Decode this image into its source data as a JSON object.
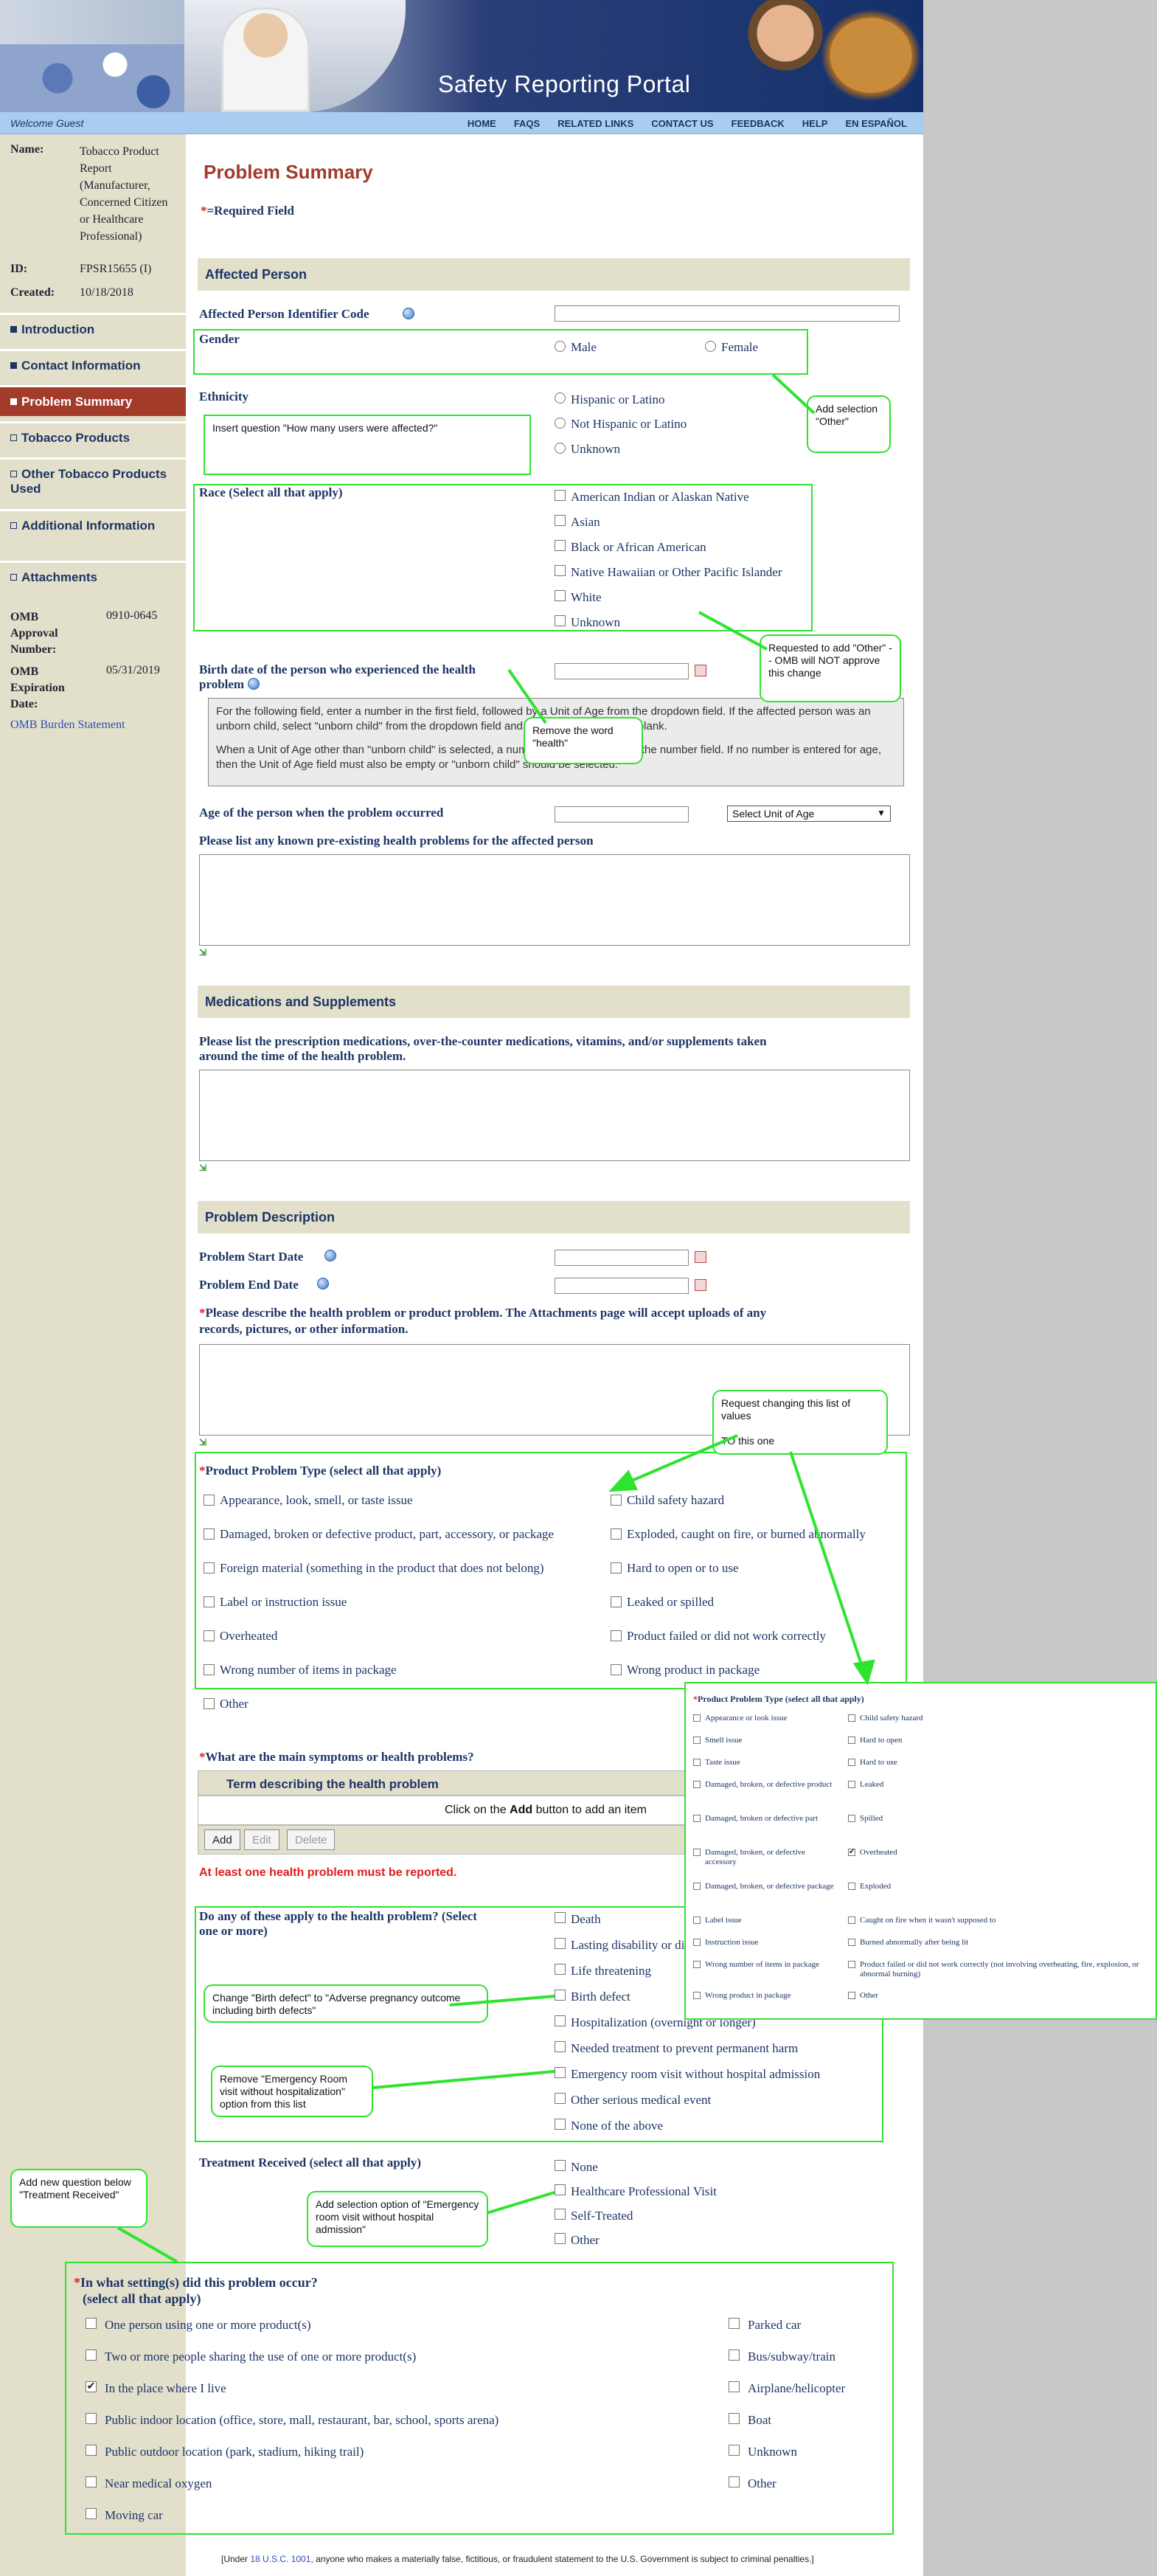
{
  "header": {
    "title": "Safety Reporting Portal",
    "welcome": "Welcome Guest",
    "nav": [
      "HOME",
      "FAQS",
      "RELATED LINKS",
      "CONTACT US",
      "FEEDBACK",
      "HELP",
      "EN ESPAÑOL"
    ]
  },
  "sidebar": {
    "name_label": "Name:",
    "name_value": "Tobacco Product Report (Manufacturer, Concerned Citizen or Healthcare Professional)",
    "id_label": "ID:",
    "id_value": "FPSR15655 (I)",
    "created_label": "Created:",
    "created_value": "10/18/2018",
    "items": [
      "Introduction",
      "Contact Information",
      "Problem Summary",
      "Tobacco Products",
      "Other Tobacco Products Used",
      "Additional Information",
      "Attachments"
    ],
    "omb_number_label": "OMB Approval Number:",
    "omb_number_value": "0910-0645",
    "omb_exp_label": "OMB Expiration Date:",
    "omb_exp_value": "05/31/2019",
    "burden_link": "OMB Burden Statement"
  },
  "main": {
    "title": "Problem Summary",
    "required_note": "=Required Field",
    "sections": {
      "affected": "Affected Person",
      "medications": "Medications and Supplements",
      "problem": "Problem Description"
    },
    "affected": {
      "identifier_label": "Affected Person Identifier Code",
      "gender_label": "Gender",
      "gender_options": [
        "Male",
        "Female"
      ],
      "ethnicity_label": "Ethnicity",
      "ethnicity_options": [
        "Hispanic or Latino",
        "Not Hispanic or Latino",
        "Unknown"
      ],
      "race_label": "Race (Select all that apply)",
      "race_options": [
        "American Indian or Alaskan Native",
        "Asian",
        "Black or African American",
        "Native Hawaiian or Other Pacific Islander",
        "White",
        "Unknown"
      ],
      "birth_label_1": "Birth date of the person who experienced the health",
      "birth_label_2": "problem",
      "info_1": "For the following field, enter a number in the first field, followed by a Unit of Age from the dropdown field. If the affected person was an unborn child, select \"unborn child\" from the dropdown field and leave the number field blank.",
      "info_2": "When a Unit of Age other than \"unborn child\" is selected, a number must be entered in the number field. If no number is entered for age, then the Unit of Age field must also be empty or \"unborn child\" should be selected.",
      "age_label": "Age of the person when the problem occurred",
      "age_unit_select": "Select Unit of Age",
      "preexisting_label": "Please list any known pre-existing health problems for the affected person"
    },
    "medications_label_1": "Please list the prescription medications, over-the-counter medications, vitamins, and/or supplements taken",
    "medications_label_2": "around the time of the health problem.",
    "problem": {
      "start_label": "Problem Start Date",
      "end_label": "Problem End Date",
      "describe_1": "Please describe the health problem or product problem. The Attachments page will accept uploads of any",
      "describe_2": "records, pictures, or other information.",
      "type_label": "Product Problem Type (select all that apply)",
      "type_left": [
        "Appearance, look, smell, or taste issue",
        "Damaged, broken or defective product, part, accessory, or package",
        "Foreign material (something in the product that does not belong)",
        "Label or instruction issue",
        "Overheated",
        "Wrong number of items in package",
        "Other"
      ],
      "type_right": [
        "Child safety hazard",
        "Exploded, caught on fire, or burned abnormally",
        "Hard to open or to use",
        "Leaked or spilled",
        "Product failed or did not work correctly",
        "Wrong product in package"
      ],
      "symptoms_label": "What are the main symptoms or health problems?",
      "table_header": "Term describing the health problem",
      "table_hint_pre": "Click on the ",
      "table_hint_bold": "Add",
      "table_hint_post": " button to add an item",
      "btn_add": "Add",
      "btn_edit": "Edit",
      "btn_delete": "Delete",
      "error": "At least one health problem must be reported.",
      "apply_label_1": "Do any of these apply to the health problem? (Select",
      "apply_label_2": "one or more)",
      "apply_options": [
        "Death",
        "Lasting disability or di",
        "Life threatening",
        "Birth defect",
        "Hospitalization (overnight or longer)",
        "Needed treatment to prevent permanent harm",
        "Emergency room visit without hospital admission",
        "Other serious medical event",
        "None of the above"
      ],
      "treatment_label": "Treatment Received (select all that apply)",
      "treatment_options": [
        "None",
        "Healthcare Professional Visit",
        "Self-Treated",
        "Other"
      ]
    },
    "setting": {
      "label_1": "In what setting(s) did this problem occur?",
      "label_2": "(select all that apply)",
      "left": [
        "One person using one or more product(s)",
        "Two or more people sharing the use of one or more product(s)",
        "In the place where I live",
        "Public indoor location (office, store, mall, restaurant, bar, school, sports arena)",
        "Public outdoor location (park, stadium, hiking trail)",
        "Near medical oxygen",
        "Moving car"
      ],
      "left_checked": [
        false,
        false,
        true,
        false,
        false,
        false,
        false
      ],
      "right": [
        "Parked car",
        "Bus/subway/train",
        "Airplane/helicopter",
        "Boat",
        "Unknown",
        "Other"
      ]
    },
    "footer_pre": "[Under ",
    "footer_link": "18 U.S.C. 1001",
    "footer_post": ", anyone who makes a materially false, fictitious, or fraudulent statement to the U.S. Government is subject to criminal penalties.]"
  },
  "callouts": {
    "gender": "Add selection \"Other\"",
    "ethnicity": "Insert question  \"How many users were affected?\"",
    "race": "Requested to add \"Other\" -- OMB will NOT approve this change",
    "health": "Remove the word \"health\"",
    "problem_type": "Request changing this list of values\n\nTO this one",
    "birth_defect": "Change \"Birth defect\" to \"Adverse pregnancy outcome including birth defects\"",
    "er": "Remove \"Emergency Room visit without hospitalization\" option from this list",
    "new_question": "Add new question below \"Treatment Received\"",
    "treatment": "Add selection option of \"Emergency room visit without hospital admission\""
  },
  "popup": {
    "title": "Product Problem Type (select all that apply)",
    "left": [
      "Appearance or look issue",
      "Smell issue",
      "Taste issue",
      "Damaged, broken, or defective product",
      "Damaged, broken or defective part",
      "Damaged, broken, or defective accessory",
      "Damaged, broken, or defective package",
      "Label issue",
      "Instruction issue",
      "Wrong number of items in package",
      "Wrong product in package"
    ],
    "right": [
      "Child safety hazard",
      "Hard to open",
      "Hard to use",
      "Leaked",
      "Spilled",
      "Overheated",
      "Exploded",
      "Caught on fire when it wasn't supposed to",
      "Burned abnormally after being lit",
      "Product failed or did not work correctly (not involving overheating, fire, explosion, or abnormal burning)",
      "Other"
    ],
    "right_checked": [
      false,
      false,
      false,
      false,
      false,
      true,
      false,
      false,
      false,
      false,
      false
    ]
  },
  "colors": {
    "accent": "#a33b2b",
    "navy": "#1d3565",
    "highlight": "#2fe32f",
    "required": "#d92323"
  }
}
